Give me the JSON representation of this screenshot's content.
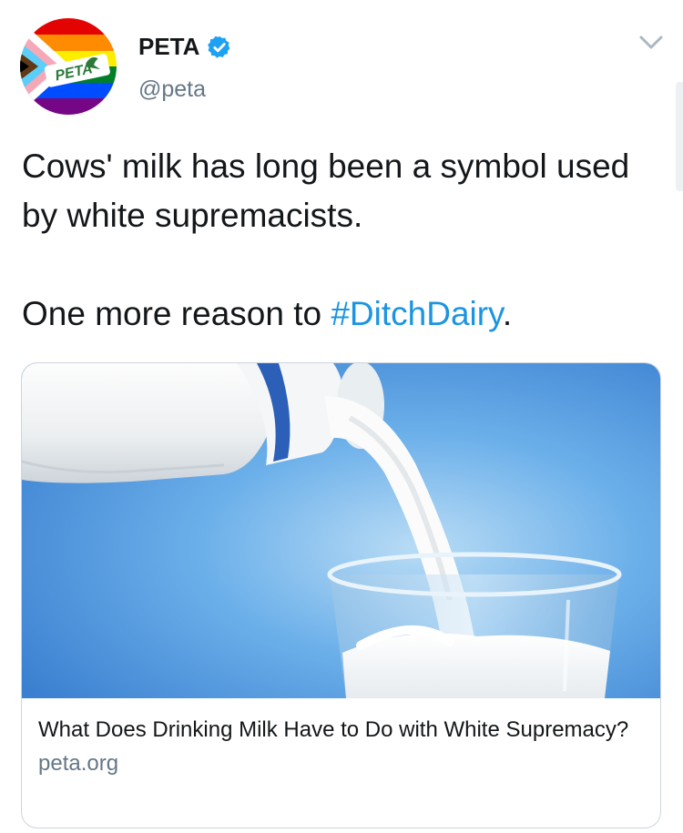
{
  "tweet": {
    "author": {
      "display_name": "PETA",
      "handle": "@peta",
      "verified": true,
      "avatar_icon": "peta-rainbow-flag-logo",
      "avatar_logo_text": "PETA"
    },
    "menu_icon": "chevron-down-icon",
    "text_line1": "Cows' milk has long been a symbol used by white supremacists.",
    "text_line2_prefix": "One more reason to ",
    "hashtag": "#DitchDairy",
    "text_line2_suffix": "."
  },
  "card": {
    "image_subject": "milk-pouring-into-glass",
    "title": "What Does Drinking Milk Have to Do with White Supremacy?",
    "domain": "peta.org"
  },
  "colors": {
    "link": "#1b95e0",
    "verified": "#1da1f2",
    "secondary_text": "#657786",
    "card_border": "#ccd6dd"
  }
}
